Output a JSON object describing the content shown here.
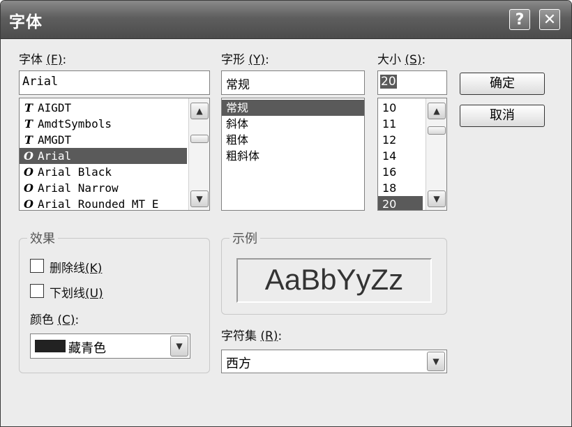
{
  "window": {
    "title": "字体",
    "help_label": "?",
    "close_label": "✕"
  },
  "font": {
    "label_text": "字体",
    "label_key": "(F)",
    "label_suffix": ":",
    "value": "Arial",
    "items": [
      {
        "icon": "truetype-icon",
        "glyph": "T",
        "name": "AIGDT",
        "selected": false
      },
      {
        "icon": "truetype-icon",
        "glyph": "T",
        "name": "AmdtSymbols",
        "selected": false
      },
      {
        "icon": "truetype-icon",
        "glyph": "T",
        "name": "AMGDT",
        "selected": false
      },
      {
        "icon": "opentype-icon",
        "glyph": "O",
        "name": "Arial",
        "selected": true
      },
      {
        "icon": "opentype-icon",
        "glyph": "O",
        "name": "Arial Black",
        "selected": false
      },
      {
        "icon": "opentype-icon",
        "glyph": "O",
        "name": "Arial Narrow",
        "selected": false
      },
      {
        "icon": "opentype-icon",
        "glyph": "O",
        "name": "Arial Rounded MT E",
        "selected": false
      }
    ]
  },
  "style": {
    "label_text": "字形",
    "label_key": "(Y)",
    "label_suffix": ":",
    "value": "常规",
    "items": [
      {
        "name": "常规",
        "selected": true
      },
      {
        "name": "斜体",
        "selected": false
      },
      {
        "name": "粗体",
        "selected": false
      },
      {
        "name": "粗斜体",
        "selected": false
      }
    ]
  },
  "size": {
    "label_text": "大小",
    "label_key": "(S)",
    "label_suffix": ":",
    "value": "20",
    "items": [
      {
        "name": "10",
        "selected": false
      },
      {
        "name": "11",
        "selected": false
      },
      {
        "name": "12",
        "selected": false
      },
      {
        "name": "14",
        "selected": false
      },
      {
        "name": "16",
        "selected": false
      },
      {
        "name": "18",
        "selected": false
      },
      {
        "name": "20",
        "selected": true
      }
    ]
  },
  "buttons": {
    "ok": "确定",
    "cancel": "取消"
  },
  "effects": {
    "title": "效果",
    "strikeout_text": "删除线",
    "strikeout_key": "(K)",
    "underline_text": "下划线",
    "underline_key": "(U)",
    "color_label_text": "颜色",
    "color_label_key": "(C)",
    "color_label_suffix": ":",
    "color_value": "藏青色",
    "color_swatch": "#222222"
  },
  "sample": {
    "title": "示例",
    "text": "AaBbYyZz"
  },
  "charset": {
    "label_text": "字符集",
    "label_key": "(R)",
    "label_suffix": ":",
    "value": "西方"
  },
  "icons": {
    "scroll_up": "▲",
    "scroll_down": "▼"
  }
}
